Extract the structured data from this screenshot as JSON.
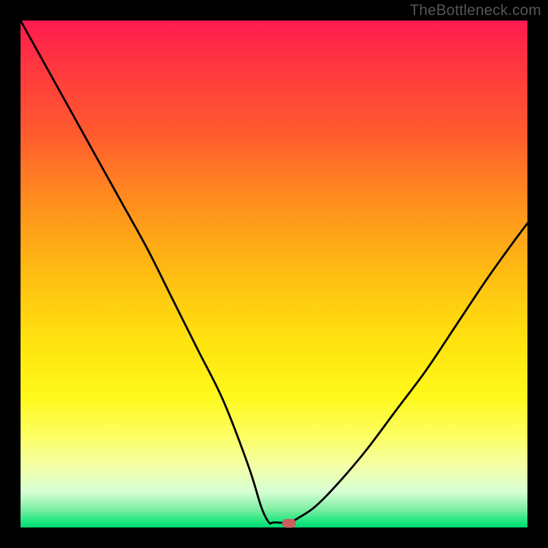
{
  "watermark": "TheBottleneck.com",
  "plot": {
    "x_range": [
      0,
      1
    ],
    "y_range": [
      0,
      1
    ],
    "gradient_direction": "top-to-bottom",
    "gradient_meaning": "red high bottleneck, green low bottleneck"
  },
  "chart_data": {
    "type": "line",
    "title": "",
    "xlabel": "",
    "ylabel": "",
    "xlim": [
      0,
      1
    ],
    "ylim": [
      0,
      1
    ],
    "x": [
      0.0,
      0.05,
      0.1,
      0.15,
      0.2,
      0.25,
      0.3,
      0.35,
      0.4,
      0.45,
      0.475,
      0.49,
      0.5,
      0.53,
      0.55,
      0.58,
      0.62,
      0.68,
      0.74,
      0.8,
      0.86,
      0.92,
      0.97,
      1.0
    ],
    "values": [
      1.0,
      0.91,
      0.82,
      0.73,
      0.64,
      0.55,
      0.45,
      0.35,
      0.25,
      0.12,
      0.04,
      0.01,
      0.01,
      0.01,
      0.02,
      0.04,
      0.08,
      0.15,
      0.23,
      0.31,
      0.4,
      0.49,
      0.56,
      0.6
    ],
    "marker": {
      "x": 0.53,
      "y": 0.008
    },
    "series_name": "bottleneck-curve"
  },
  "colors": {
    "curve": "#000000",
    "marker_fill": "#cd5c5c",
    "background": "#000000"
  }
}
